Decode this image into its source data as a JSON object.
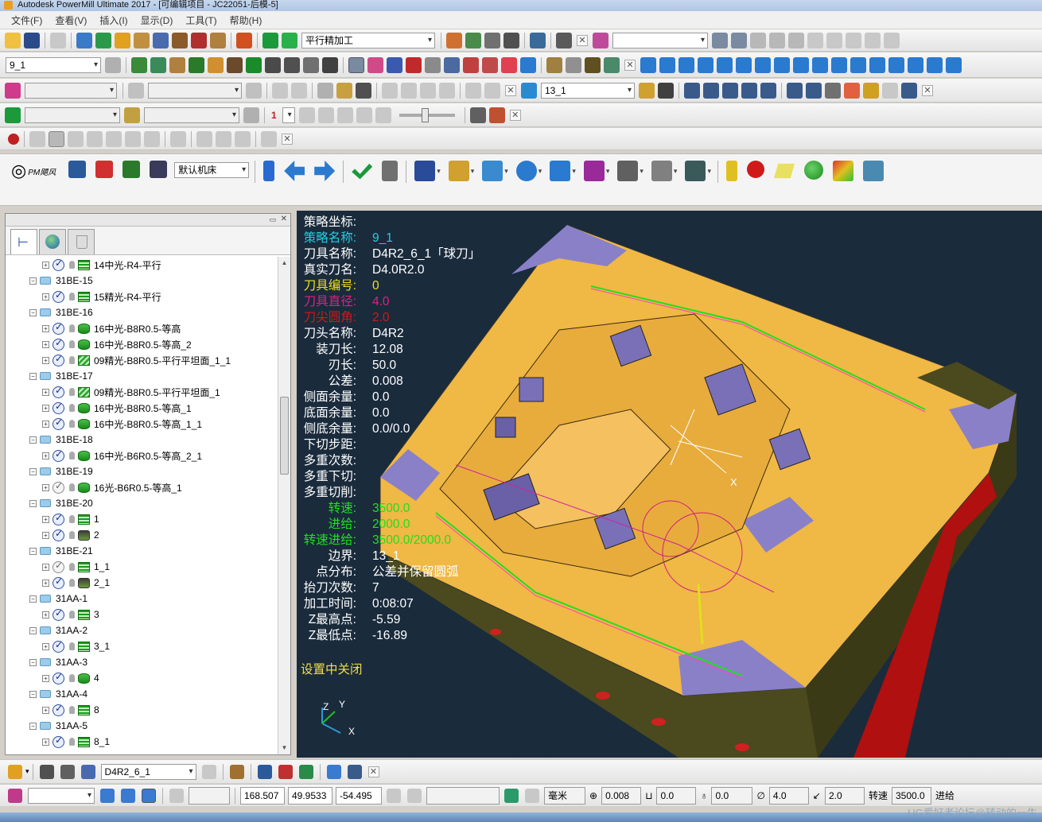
{
  "window": {
    "title": "Autodesk PowerMill Ultimate 2017 - [可编辑项目 - JC22051-后模-5]"
  },
  "menu": [
    "文件(F)",
    "查看(V)",
    "插入(I)",
    "显示(D)",
    "工具(T)",
    "帮助(H)"
  ],
  "toolbar": {
    "toolpath_combo": "平行精加工",
    "pattern_combo": "",
    "toolpath_select": "9_1",
    "boundary_combo": "",
    "feature_combo": "",
    "level_set_combo": "13_1",
    "simulation_combo": "",
    "simulation_tool_combo": "",
    "step_count": "1"
  },
  "plugin": {
    "brand": "PM飓风",
    "machine_combo": "默认机床"
  },
  "tree": [
    {
      "type": "item",
      "label": "14中光-R4-平行",
      "icon": "flat",
      "check": "on"
    },
    {
      "type": "folder",
      "label": "31BE-15"
    },
    {
      "type": "item",
      "label": "15精光-R4-平行",
      "icon": "flat",
      "check": "on"
    },
    {
      "type": "folder",
      "label": "31BE-16"
    },
    {
      "type": "item",
      "label": "16中光-B8R0.5-等高",
      "icon": "const",
      "check": "on"
    },
    {
      "type": "item",
      "label": "16中光-B8R0.5-等高_2",
      "icon": "const",
      "check": "on"
    },
    {
      "type": "item",
      "label": "09精光-B8R0.5-平行平坦面_1_1",
      "icon": "raster",
      "check": "on"
    },
    {
      "type": "folder",
      "label": "31BE-17"
    },
    {
      "type": "item",
      "label": "09精光-B8R0.5-平行平坦面_1",
      "icon": "raster",
      "check": "on"
    },
    {
      "type": "item",
      "label": "16中光-B8R0.5-等高_1",
      "icon": "const",
      "check": "on"
    },
    {
      "type": "item",
      "label": "16中光-B8R0.5-等高_1_1",
      "icon": "const",
      "check": "on"
    },
    {
      "type": "folder",
      "label": "31BE-18"
    },
    {
      "type": "item",
      "label": "16中光-B6R0.5-等高_2_1",
      "icon": "const",
      "check": "on"
    },
    {
      "type": "folder",
      "label": "31BE-19"
    },
    {
      "type": "item",
      "label": "16光-B6R0.5-等高_1",
      "icon": "const",
      "check": "gray"
    },
    {
      "type": "folder",
      "label": "31BE-20"
    },
    {
      "type": "item",
      "label": "1",
      "icon": "flat",
      "check": "on"
    },
    {
      "type": "item",
      "label": "2",
      "icon": "drill",
      "check": "on"
    },
    {
      "type": "folder",
      "label": "31BE-21"
    },
    {
      "type": "item",
      "label": "1_1",
      "icon": "flat",
      "check": "gray"
    },
    {
      "type": "item",
      "label": "2_1",
      "icon": "drill",
      "check": "on"
    },
    {
      "type": "folder",
      "label": "31AA-1"
    },
    {
      "type": "item",
      "label": "3",
      "icon": "flat",
      "check": "on"
    },
    {
      "type": "folder",
      "label": "31AA-2"
    },
    {
      "type": "item",
      "label": "3_1",
      "icon": "flat",
      "check": "on"
    },
    {
      "type": "folder",
      "label": "31AA-3"
    },
    {
      "type": "item",
      "label": "4",
      "icon": "const",
      "check": "on"
    },
    {
      "type": "folder",
      "label": "31AA-4"
    },
    {
      "type": "item",
      "label": "8",
      "icon": "flat",
      "check": "on"
    },
    {
      "type": "folder",
      "label": "31AA-5"
    },
    {
      "type": "item",
      "label": "8_1",
      "icon": "flat",
      "check": "on"
    }
  ],
  "info": [
    {
      "k": "策略坐标:",
      "v": "",
      "color": "#ffffff"
    },
    {
      "k": "策略名称:",
      "v": "9_1",
      "color": "#20d0e0"
    },
    {
      "k": "刀具名称:",
      "v": "D4R2_6_1「球刀」",
      "color": "#ffffff"
    },
    {
      "k": "真实刀名:",
      "v": "D4.0R2.0",
      "color": "#ffffff"
    },
    {
      "k": "刀具编号:",
      "v": "0",
      "color": "#f0e020"
    },
    {
      "k": "刀具直径:",
      "v": "4.0",
      "color": "#e02080"
    },
    {
      "k": "刀尖圆角:",
      "v": "2.0",
      "color": "#d01818"
    },
    {
      "k": "刀头名称:",
      "v": "D4R2",
      "color": "#ffffff"
    },
    {
      "k": "装刀长:",
      "v": "12.08",
      "color": "#ffffff"
    },
    {
      "k": "刃长:",
      "v": "50.0",
      "color": "#ffffff"
    },
    {
      "k": "公差:",
      "v": "0.008",
      "color": "#ffffff"
    },
    {
      "k": "侧面余量:",
      "v": "0.0",
      "color": "#ffffff"
    },
    {
      "k": "底面余量:",
      "v": "0.0",
      "color": "#ffffff"
    },
    {
      "k": "侧底余量:",
      "v": "0.0/0.0",
      "color": "#ffffff"
    },
    {
      "k": "下切步距:",
      "v": "",
      "color": "#ffffff"
    },
    {
      "k": "多重次数:",
      "v": "",
      "color": "#ffffff"
    },
    {
      "k": "多重下切:",
      "v": "",
      "color": "#ffffff"
    },
    {
      "k": "多重切削:",
      "v": "",
      "color": "#ffffff"
    },
    {
      "k": "转速:",
      "v": "3500.0",
      "color": "#20e020"
    },
    {
      "k": "进给:",
      "v": "2000.0",
      "color": "#20e020"
    },
    {
      "k": "转速进给:",
      "v": "3500.0/2000.0",
      "color": "#20e020"
    },
    {
      "k": "边界:",
      "v": "13_1",
      "color": "#ffffff"
    },
    {
      "k": "点分布:",
      "v": "公差并保留圆弧",
      "color": "#ffffff"
    },
    {
      "k": "抬刀次数:",
      "v": "7",
      "color": "#ffffff"
    },
    {
      "k": "加工时间:",
      "v": "0:08:07",
      "color": "#ffffff"
    },
    {
      "k": "Z最高点:",
      "v": "-5.59",
      "color": "#ffffff"
    },
    {
      "k": "Z最低点:",
      "v": "-16.89",
      "color": "#ffffff"
    }
  ],
  "viewport": {
    "settings_off": "设置中关闭",
    "axis_z": "Z",
    "axis_y": "Y",
    "axis_x": "X"
  },
  "bottom": {
    "active_tool": "D4R2_6_1"
  },
  "status": {
    "workplane": "",
    "x": "168.507",
    "y": "49.9533",
    "z": "-54.495",
    "units": "毫米",
    "tolerance": "0.008",
    "thickness": "0.0",
    "axial_thickness": "0.0",
    "diameter": "4.0",
    "corner_radius": "2.0",
    "spindle_label": "转速",
    "spindle": "3500.0",
    "feed_label": "进给"
  },
  "watermark": "UG爱好者论坛@转动的一生"
}
